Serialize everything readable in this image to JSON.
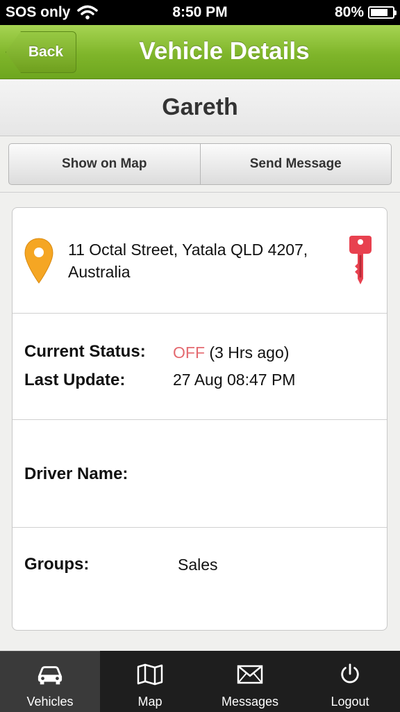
{
  "status_bar": {
    "carrier": "SOS only",
    "time": "8:50 PM",
    "battery": "80%",
    "battery_level": 0.8
  },
  "nav": {
    "back_label": "Back",
    "title": "Vehicle Details"
  },
  "vehicle": {
    "name": "Gareth"
  },
  "actions": {
    "show_on_map": "Show on Map",
    "send_message": "Send Message"
  },
  "details": {
    "address_line1": "11 Octal Street, Yatala QLD 4207,",
    "address_line2": "Australia",
    "current_status_label": "Current Status:",
    "current_status_value": "OFF",
    "current_status_age": "(3 Hrs ago)",
    "last_update_label": "Last Update:",
    "last_update_value": "27 Aug 08:47 PM",
    "driver_name_label": "Driver Name:",
    "driver_name_value": "",
    "groups_label": "Groups:",
    "groups_value": "Sales"
  },
  "tabs": [
    {
      "label": "Vehicles",
      "icon": "car-icon",
      "active": true
    },
    {
      "label": "Map",
      "icon": "map-icon",
      "active": false
    },
    {
      "label": "Messages",
      "icon": "envelope-icon",
      "active": false
    },
    {
      "label": "Logout",
      "icon": "power-icon",
      "active": false
    }
  ],
  "colors": {
    "nav_green": "#7fb52a",
    "status_off": "#e46a70",
    "pin_orange": "#f5a623",
    "key_red": "#e8414f",
    "tab_bar": "#1e1e1e"
  }
}
